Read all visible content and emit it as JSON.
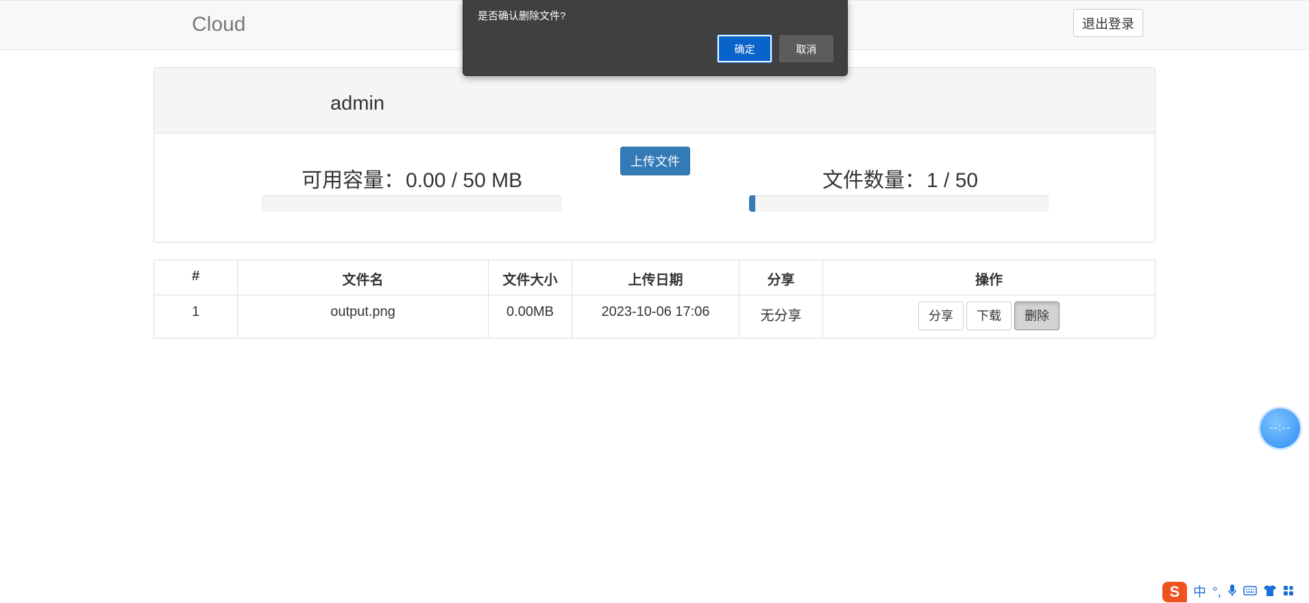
{
  "navbar": {
    "brand": "Cloud",
    "logout_label": "退出登录"
  },
  "panel": {
    "username": "admin",
    "capacity": {
      "label": "可用容量：",
      "value": "0.00 / 50 MB",
      "fraction": 0.0
    },
    "file_count": {
      "label": "文件数量：",
      "value": "1 / 50",
      "fraction": 0.02
    },
    "upload_label": "上传文件"
  },
  "table": {
    "headers": [
      "#",
      "文件名",
      "文件大小",
      "上传日期",
      "分享",
      "操作"
    ],
    "rows": [
      {
        "index": "1",
        "name": "output.png",
        "size": "0.00MB",
        "date": "2023-10-06 17:06",
        "share": "无分享",
        "actions": {
          "share": "分享",
          "download": "下载",
          "delete": "删除"
        }
      }
    ]
  },
  "dialog": {
    "message": "是否确认删除文件?",
    "ok_label": "确定",
    "cancel_label": "取消"
  },
  "widget": {
    "text": "--:--"
  },
  "ime": {
    "logo": "S",
    "mode": "中",
    "punct": "°,"
  },
  "colors": {
    "primary": "#337ab7",
    "dialog_bg": "#404040",
    "dialog_ok": "#0a63c9",
    "ime_logo": "#f0521f"
  },
  "icons": [
    "microphone-icon",
    "keyboard-icon",
    "shirt-icon",
    "grid-icon"
  ]
}
